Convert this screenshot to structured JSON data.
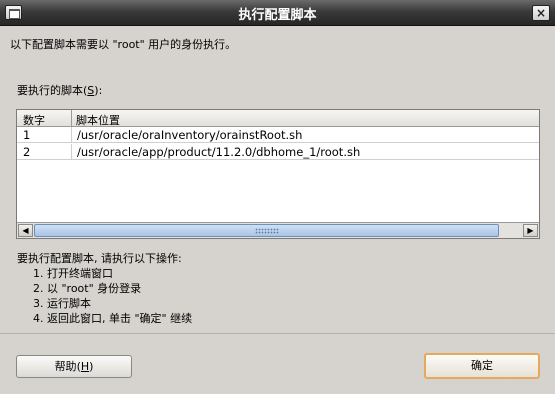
{
  "window": {
    "title": "执行配置脚本",
    "menu_icon": "window-menu-icon",
    "close_icon": "close-icon",
    "close_glyph": "×"
  },
  "description": "以下配置脚本需要以 \"root\" 用户的身份执行。",
  "scripts_label": {
    "text": "要执行的脚本",
    "mnemonic": "S",
    "suffix": ":"
  },
  "table": {
    "columns": [
      "数字",
      "脚本位置"
    ],
    "rows": [
      {
        "num": "1",
        "path": "/usr/oracle/oraInventory/orainstRoot.sh"
      },
      {
        "num": "2",
        "path": "/usr/oracle/app/product/11.2.0/dbhome_1/root.sh"
      }
    ],
    "scroll_left_glyph": "◀",
    "scroll_right_glyph": "▶"
  },
  "instructions": {
    "heading": "要执行配置脚本, 请执行以下操作:",
    "steps": [
      "1. 打开终端窗口",
      "2. 以 \"root\" 身份登录",
      "3. 运行脚本",
      "4. 返回此窗口, 单击 \"确定\" 继续"
    ]
  },
  "buttons": {
    "help_label": "帮助",
    "help_mnemonic": "H",
    "ok_label": "确定"
  }
}
